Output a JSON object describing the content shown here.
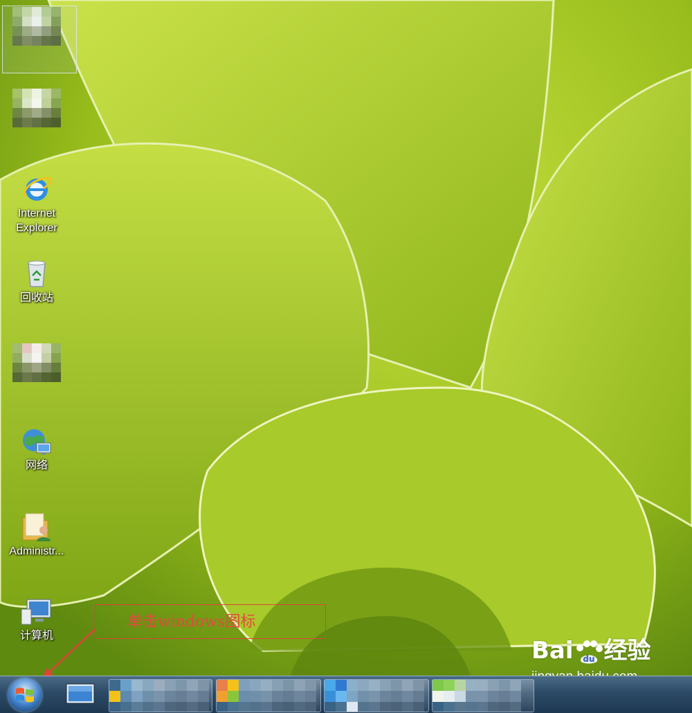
{
  "desktop": {
    "icons": [
      {
        "id": "blurred-1",
        "label": ""
      },
      {
        "id": "blurred-2",
        "label": ""
      },
      {
        "id": "ie",
        "label_line1": "Internet",
        "label_line2": "Explorer"
      },
      {
        "id": "recycle",
        "label": "回收站"
      },
      {
        "id": "blurred-3",
        "label": ""
      },
      {
        "id": "network",
        "label": "网络"
      },
      {
        "id": "admin",
        "label": "Administr..."
      },
      {
        "id": "computer",
        "label": "计算机"
      }
    ]
  },
  "annotation": {
    "text": "单击windows图标",
    "color": "#e34a3f"
  },
  "taskbar": {
    "start_icon": "windows-logo",
    "show_desktop_icon": "monitor-icon"
  },
  "watermark": {
    "brand_left": "Bai",
    "brand_right": "经验",
    "url": "jingyan.baidu.com"
  },
  "colors": {
    "accent_red": "#e0433a",
    "taskbar": "#2c4a66",
    "wallpaper_green": "#9cc21e"
  }
}
